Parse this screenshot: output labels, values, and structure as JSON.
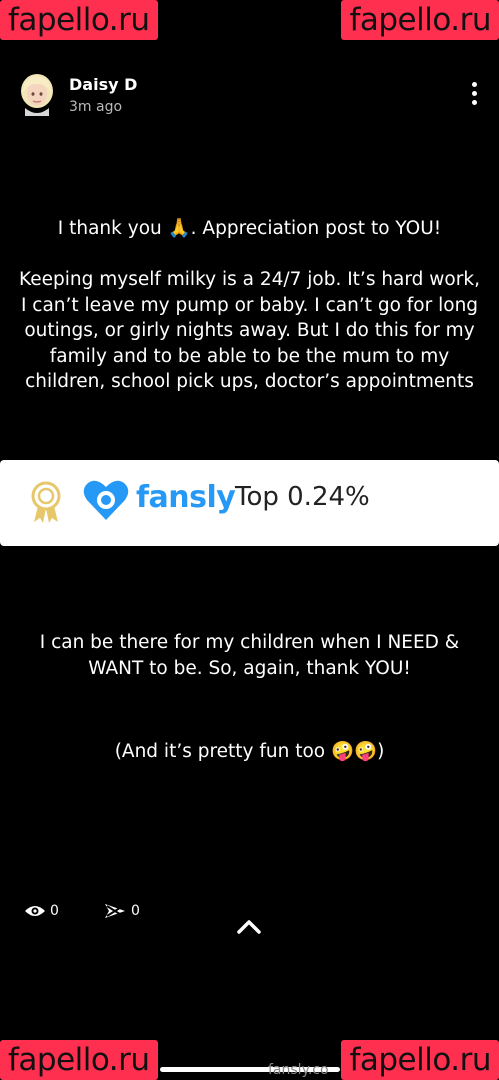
{
  "watermark": {
    "text": "fapello.ru",
    "color": "#ff2f4f"
  },
  "post": {
    "author": "Daisy D",
    "time": "3m ago",
    "menu_icon": "more-vertical-icon"
  },
  "caption": {
    "line1": "I thank you 🙏. Appreciation post to YOU!",
    "paragraph2": "Keeping myself milky is a 24/7 job. It’s hard work, I can’t leave my pump or baby. I can’t go for long outings, or girly nights away. But I do this for my family and to be able to be the mum to my children, school pick ups, doctor’s appointments",
    "paragraph3": "I can be there for my children when I NEED & WANT to be. So, again, thank YOU!",
    "paragraph4": "(And it’s pretty fun too 🤪🤪)"
  },
  "banner": {
    "brand": "fansly",
    "rank": "Top 0.24%",
    "brand_color": "#2699f7"
  },
  "stats": {
    "views": "0",
    "shares": "0"
  },
  "footer": {
    "url": "fansly.co"
  }
}
